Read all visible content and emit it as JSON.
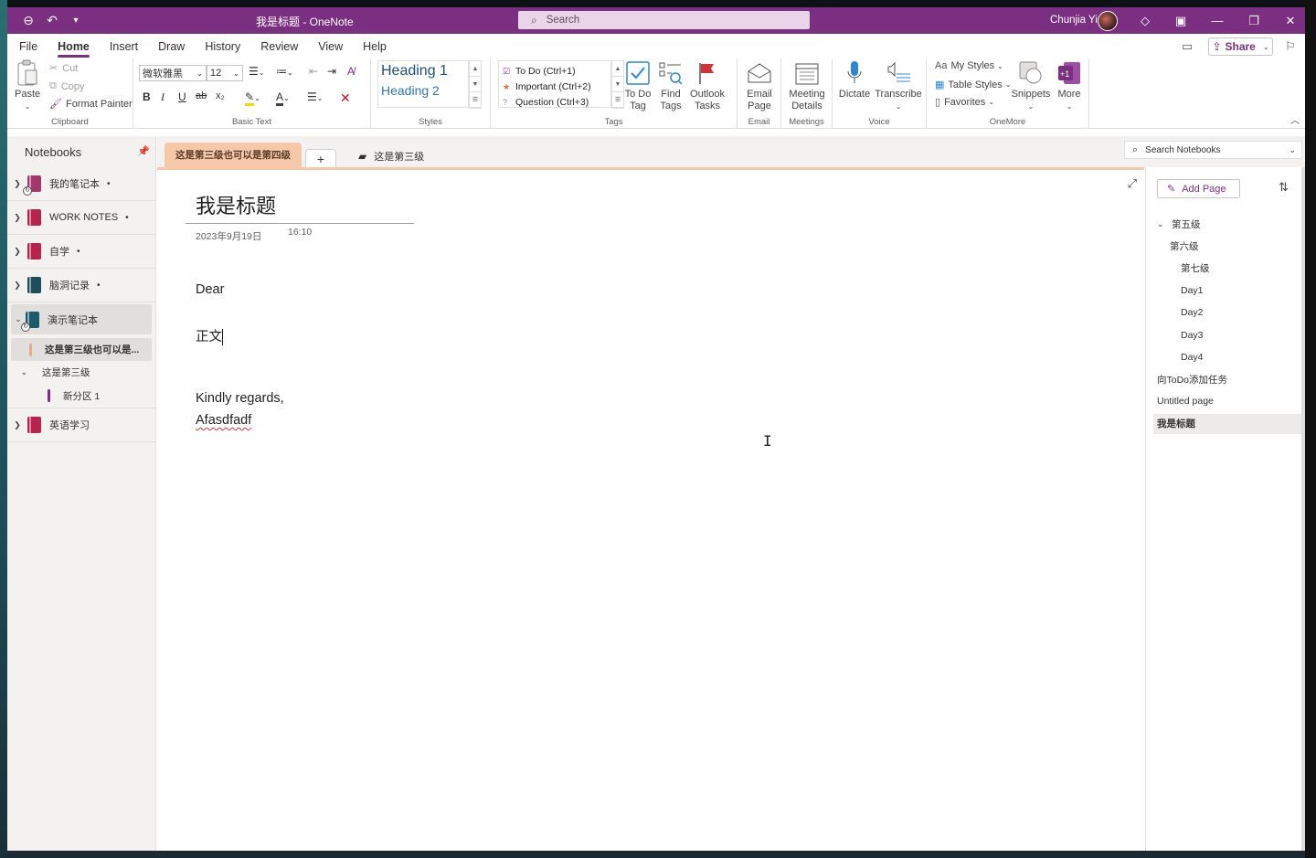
{
  "titlebar": {
    "title": "我是标题  -  OneNote",
    "search_placeholder": "Search",
    "user_name": "Chunjia Yi"
  },
  "ribbon_tabs": [
    "File",
    "Home",
    "Insert",
    "Draw",
    "History",
    "Review",
    "View",
    "Help"
  ],
  "share_label": "Share",
  "clipboard": {
    "paste": "Paste",
    "cut": "Cut",
    "copy": "Copy",
    "format_painter": "Format Painter",
    "label": "Clipboard"
  },
  "basic_text": {
    "font": "微软雅黑",
    "size": "12",
    "label": "Basic Text",
    "bold": "B",
    "italic": "I",
    "underline": "U",
    "strike": "ab",
    "subscript": "x₂"
  },
  "styles": {
    "heading1": "Heading 1",
    "heading2": "Heading 2",
    "label": "Styles"
  },
  "tags": {
    "items": [
      "To Do (Ctrl+1)",
      "Important (Ctrl+2)",
      "Question (Ctrl+3)"
    ],
    "todo_tag": "To Do Tag",
    "find_tags": "Find Tags",
    "outlook_tasks": "Outlook Tasks",
    "label": "Tags"
  },
  "email": {
    "email_page": "Email Page",
    "label": "Email"
  },
  "meetings": {
    "meeting_details": "Meeting Details",
    "label": "Meetings"
  },
  "voice": {
    "dictate": "Dictate",
    "transcribe": "Transcribe",
    "label": "Voice"
  },
  "onemore": {
    "my_styles": "My Styles",
    "table_styles": "Table Styles",
    "favorites": "Favorites",
    "snippets": "Snippets",
    "more": "More",
    "label": "OneMore"
  },
  "notebooks": {
    "header": "Notebooks",
    "items": [
      {
        "name": "我的笔记本",
        "color": "#a4376d"
      },
      {
        "name": "WORK NOTES",
        "color": "#b6234d"
      },
      {
        "name": "自学",
        "color": "#b6234d"
      },
      {
        "name": "脑洞记录",
        "color": "#1e4e5c"
      },
      {
        "name": "演示笔记本",
        "color": "#1e5a6b"
      },
      {
        "name": "英语学习",
        "color": "#b6234d"
      }
    ],
    "sections": {
      "active": "这是第三级也可以是...",
      "group": "这是第三级",
      "child": "新分区 1"
    }
  },
  "section_tabs": {
    "active": "这是第三级也可以是第四级",
    "plus": "+",
    "group": "这是第三级"
  },
  "search_notebooks": "Search Notebooks",
  "page": {
    "title": "我是标题",
    "date": "2023年9月19日",
    "time": "16:10",
    "greeting": "Dear",
    "body": "正文",
    "closing": "Kindly regards,",
    "signature": "Afasdfadf"
  },
  "pages_panel": {
    "add_page": "Add Page",
    "pages": [
      {
        "title": "第五级",
        "level": 1
      },
      {
        "title": "第六级",
        "level": 2
      },
      {
        "title": "第七级",
        "level": 3
      },
      {
        "title": "Day1",
        "level": 3
      },
      {
        "title": "Day2",
        "level": 3
      },
      {
        "title": "Day3",
        "level": 3
      },
      {
        "title": "Day4",
        "level": 3
      },
      {
        "title": "向ToDo添加任务",
        "level": 1
      },
      {
        "title": "Untitled page",
        "level": 1
      },
      {
        "title": "我是标题",
        "level": 1
      }
    ]
  },
  "colors": {
    "accent": "#7b2f80",
    "section_tab": "#f4c8a8"
  }
}
